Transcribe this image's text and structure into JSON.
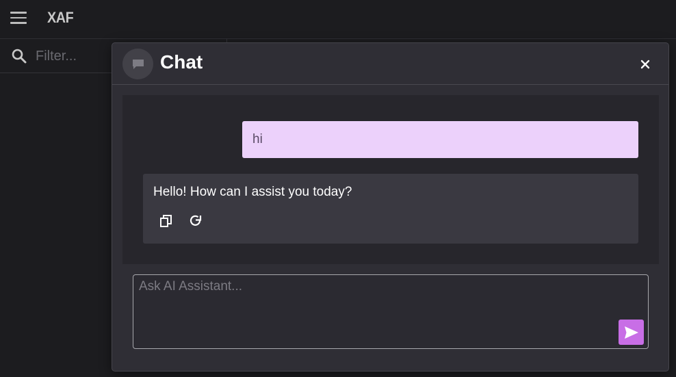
{
  "app": {
    "title": "XAF"
  },
  "sidebar": {
    "filter_placeholder": "Filter..."
  },
  "dialog": {
    "title": "Chat",
    "messages": [
      {
        "role": "user",
        "text": "hi"
      },
      {
        "role": "assistant",
        "text": "Hello! How can I assist you today?"
      }
    ],
    "input_placeholder": "Ask AI Assistant..."
  },
  "colors": {
    "accent": "#c86ee6",
    "user_bubble": "#ecd1fb"
  },
  "icons": [
    "menu-icon",
    "search-icon",
    "chat-icon",
    "close-icon",
    "copy-icon",
    "refresh-icon",
    "send-icon"
  ]
}
